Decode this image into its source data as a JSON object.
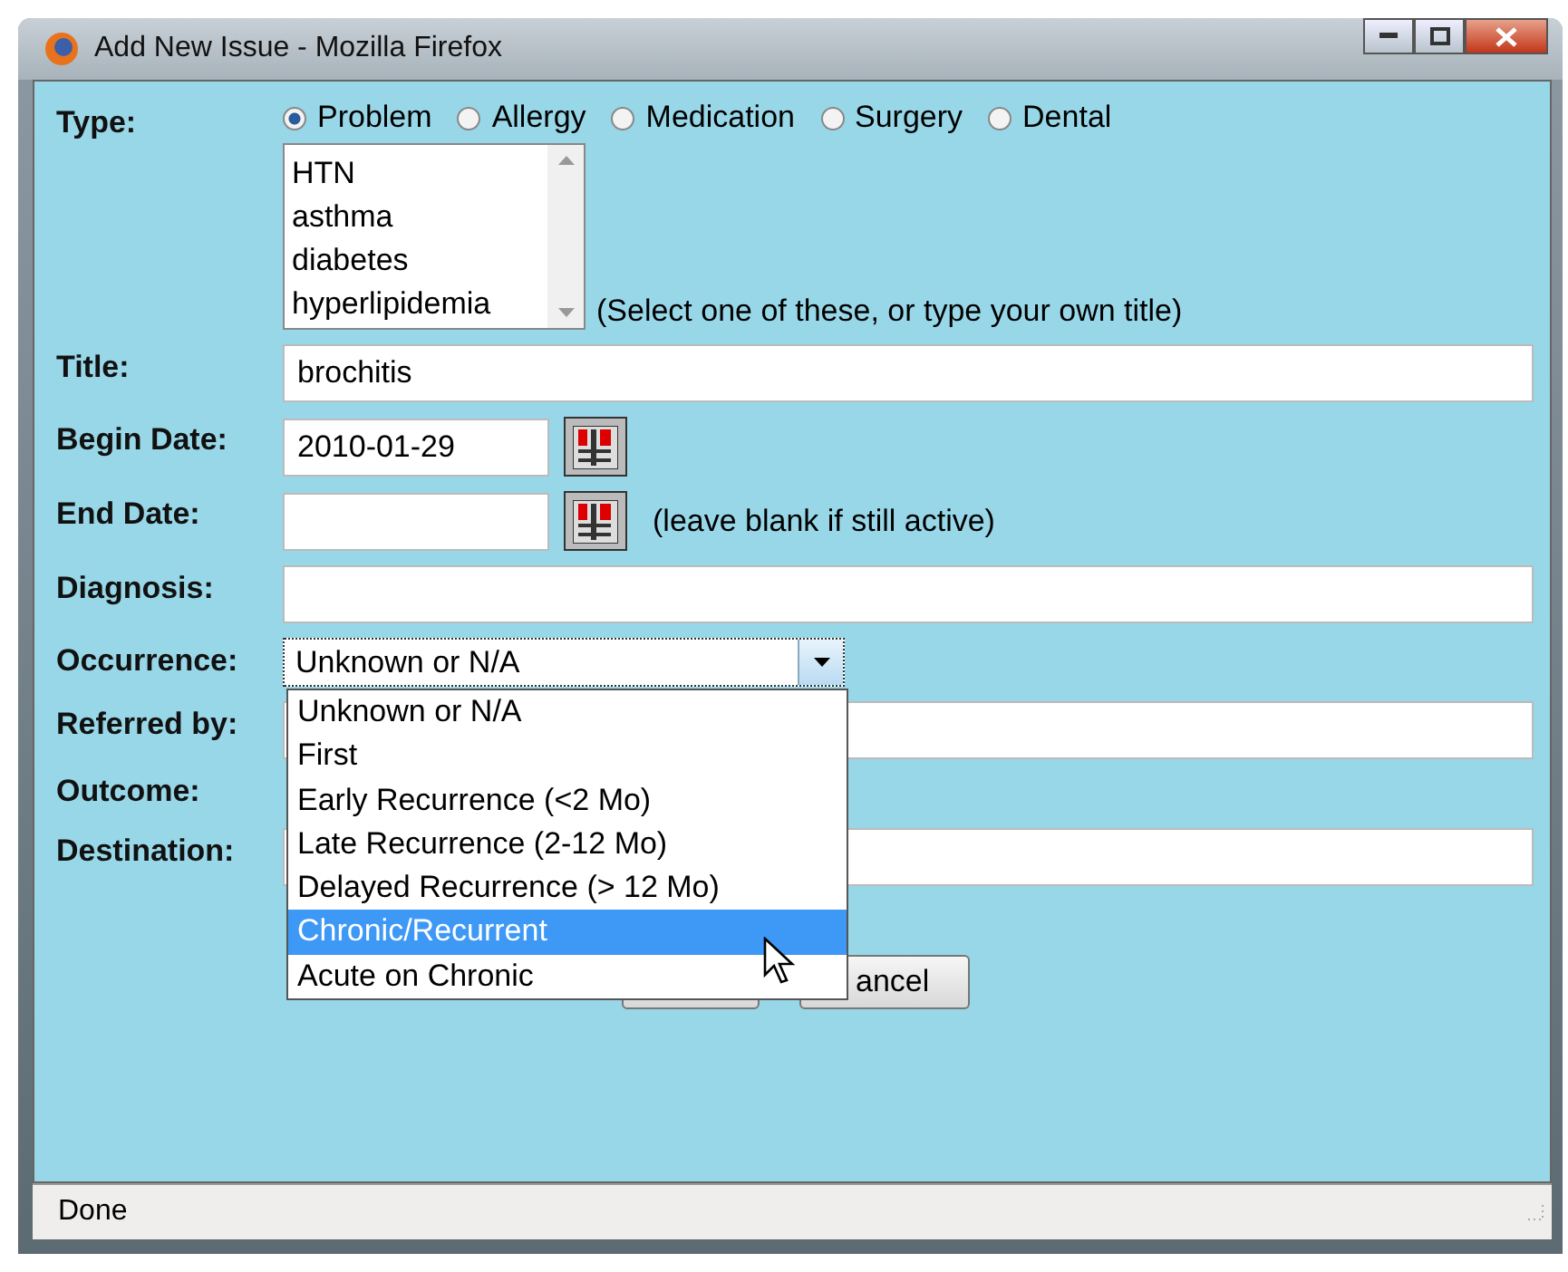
{
  "window": {
    "title": "Add New Issue - Mozilla Firefox"
  },
  "type": {
    "label": "Type:",
    "options": [
      {
        "label": "Problem",
        "selected": true
      },
      {
        "label": "Allergy",
        "selected": false
      },
      {
        "label": "Medication",
        "selected": false
      },
      {
        "label": "Surgery",
        "selected": false
      },
      {
        "label": "Dental",
        "selected": false
      }
    ],
    "title_list": [
      "HTN",
      "asthma",
      "diabetes",
      "hyperlipidemia"
    ],
    "hint": "(Select one of these, or type your own title)"
  },
  "title": {
    "label": "Title:",
    "value": "brochitis"
  },
  "begin_date": {
    "label": "Begin Date:",
    "value": "2010-01-29"
  },
  "end_date": {
    "label": "End Date:",
    "hint": "(leave blank if still active)"
  },
  "diagnosis": {
    "label": "Diagnosis:"
  },
  "occurrence": {
    "label": "Occurrence:",
    "value": "Unknown or N/A",
    "expanded": true,
    "options": [
      {
        "label": "Unknown or N/A",
        "highlighted": false
      },
      {
        "label": "First",
        "highlighted": false
      },
      {
        "label": "Early Recurrence (<2 Mo)",
        "highlighted": false
      },
      {
        "label": "Late Recurrence (2-12 Mo)",
        "highlighted": false
      },
      {
        "label": "Delayed Recurrence (> 12 Mo)",
        "highlighted": false
      },
      {
        "label": "Chronic/Recurrent",
        "highlighted": true
      },
      {
        "label": "Acute on Chronic",
        "highlighted": false
      }
    ]
  },
  "referred_by": {
    "label": "Referred by:"
  },
  "outcome": {
    "label": "Outcome:"
  },
  "destination": {
    "label": "Destination:"
  },
  "cancel_button": {
    "label": "ancel"
  },
  "status_bar": {
    "text": "Done"
  }
}
